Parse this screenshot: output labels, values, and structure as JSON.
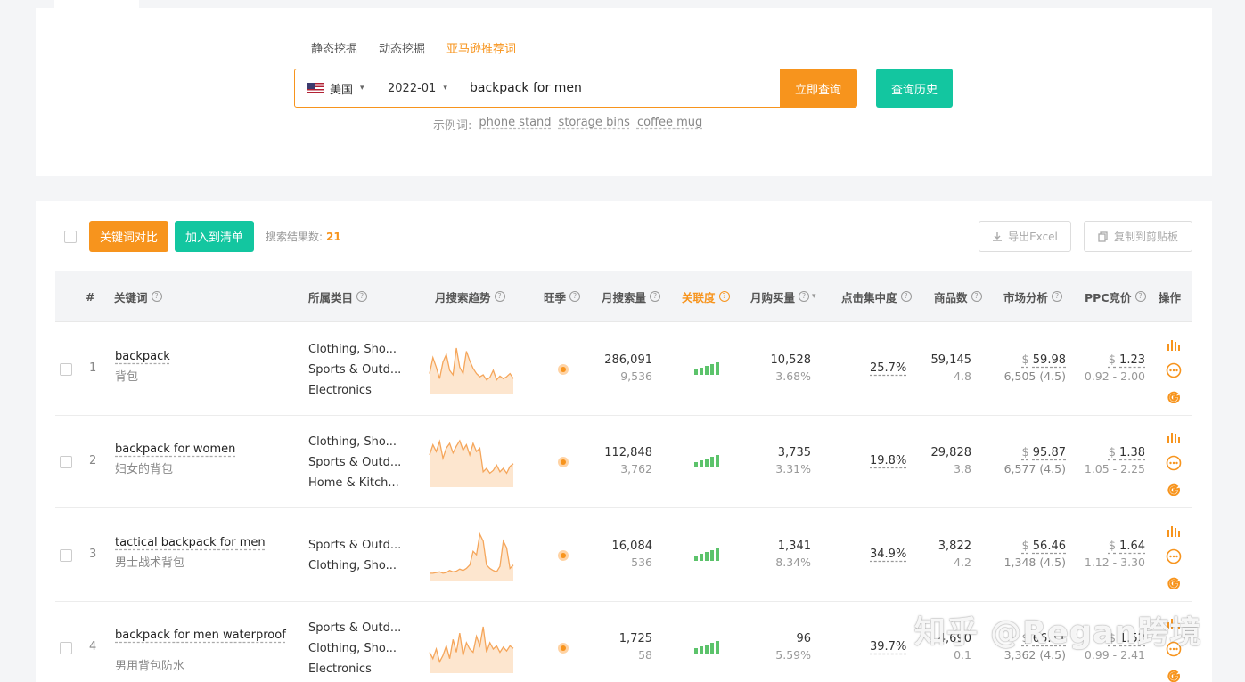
{
  "search": {
    "modes": [
      "静态挖掘",
      "动态挖掘",
      "亚马逊推荐词"
    ],
    "active_mode": "亚马逊推荐词",
    "country": "美国",
    "month": "2022-01",
    "keyword": "backpack for men",
    "query_button": "立即查询",
    "history_button": "查询历史",
    "examples_label": "示例词:",
    "examples": [
      "phone stand",
      "storage bins",
      "coffee mug"
    ]
  },
  "toolbar": {
    "compare_button": "关键词对比",
    "add_list_button": "加入到清单",
    "result_count_label": "搜索结果数:",
    "result_count": "21",
    "export_button": "导出Excel",
    "copy_button": "复制到剪贴板"
  },
  "table": {
    "headers": {
      "index": "#",
      "keyword": "关键词",
      "category": "所属类目",
      "trend": "月搜索趋势",
      "season": "旺季",
      "search_volume": "月搜索量",
      "relevance": "关联度",
      "purchases": "月购买量",
      "click_concentration": "点击集中度",
      "products": "商品数",
      "market": "市场分析",
      "ppc": "PPC竞价",
      "actions": "操作"
    },
    "rows": [
      {
        "index": "1",
        "kw_en": "backpack",
        "kw_cn": "背包",
        "categories": [
          "Clothing, Sho...",
          "Sports & Outd...",
          "Electronics"
        ],
        "trend": [
          30,
          55,
          40,
          22,
          48,
          60,
          35,
          28,
          70,
          40,
          30,
          65,
          50,
          38,
          30,
          25,
          28,
          20,
          24,
          35,
          20,
          26,
          22,
          25,
          30,
          22
        ],
        "volume": "286,091",
        "volume_sub": "9,536",
        "relevance": 5,
        "purchases": "10,528",
        "purchases_sub": "3.68%",
        "click": "25.7%",
        "products": "59,145",
        "products_sub": "4.8",
        "market_price": "59.98",
        "market_sub": "6,505 (4.5)",
        "ppc": "1.23",
        "ppc_range": "0.92 - 2.00"
      },
      {
        "index": "2",
        "kw_en": "backpack for women",
        "kw_cn": "妇女的背包",
        "categories": [
          "Clothing, Sho...",
          "Sports & Outd...",
          "Home & Kitch..."
        ],
        "trend": [
          45,
          60,
          50,
          65,
          40,
          55,
          62,
          48,
          58,
          66,
          52,
          60,
          45,
          62,
          50,
          55,
          20,
          25,
          18,
          22,
          30,
          20,
          25,
          18,
          28,
          32
        ],
        "volume": "112,848",
        "volume_sub": "3,762",
        "relevance": 5,
        "purchases": "3,735",
        "purchases_sub": "3.31%",
        "click": "19.8%",
        "products": "29,828",
        "products_sub": "3.8",
        "market_price": "95.87",
        "market_sub": "6,577 (4.5)",
        "ppc": "1.38",
        "ppc_range": "1.05 - 2.25"
      },
      {
        "index": "3",
        "kw_en": "tactical backpack for men",
        "kw_cn": "男士战术背包",
        "categories": [
          "Sports & Outd...",
          "Clothing, Sho..."
        ],
        "trend": [
          8,
          8,
          9,
          10,
          8,
          9,
          12,
          10,
          11,
          14,
          12,
          15,
          20,
          40,
          35,
          65,
          55,
          20,
          15,
          12,
          10,
          18,
          55,
          45,
          15,
          20
        ],
        "volume": "16,084",
        "volume_sub": "536",
        "relevance": 5,
        "purchases": "1,341",
        "purchases_sub": "8.34%",
        "click": "34.9%",
        "products": "3,822",
        "products_sub": "4.2",
        "market_price": "56.46",
        "market_sub": "1,348 (4.5)",
        "ppc": "1.64",
        "ppc_range": "1.12 - 3.30"
      },
      {
        "index": "4",
        "kw_en": "backpack for men waterproof",
        "kw_cn": "男用背包防水",
        "categories": [
          "Sports & Outd...",
          "Clothing, Sho...",
          "Electronics"
        ],
        "trend": [
          30,
          20,
          35,
          15,
          25,
          40,
          20,
          50,
          30,
          60,
          25,
          45,
          35,
          30,
          55,
          40,
          70,
          30,
          45,
          35,
          40,
          30,
          38,
          32,
          40,
          36
        ],
        "volume": "1,725",
        "volume_sub": "58",
        "relevance": 5,
        "purchases": "96",
        "purchases_sub": "5.59%",
        "click": "39.7%",
        "products": "4,690",
        "products_sub": "0.1",
        "market_price": "66.11",
        "market_sub": "3,362 (4.5)",
        "ppc": "1.52",
        "ppc_range": "0.99 - 2.41"
      }
    ]
  },
  "watermark": "知乎 @Regan跨境",
  "colors": {
    "accent": "#f7941d",
    "teal": "#13c6a0",
    "bars": "#5cc36b"
  }
}
